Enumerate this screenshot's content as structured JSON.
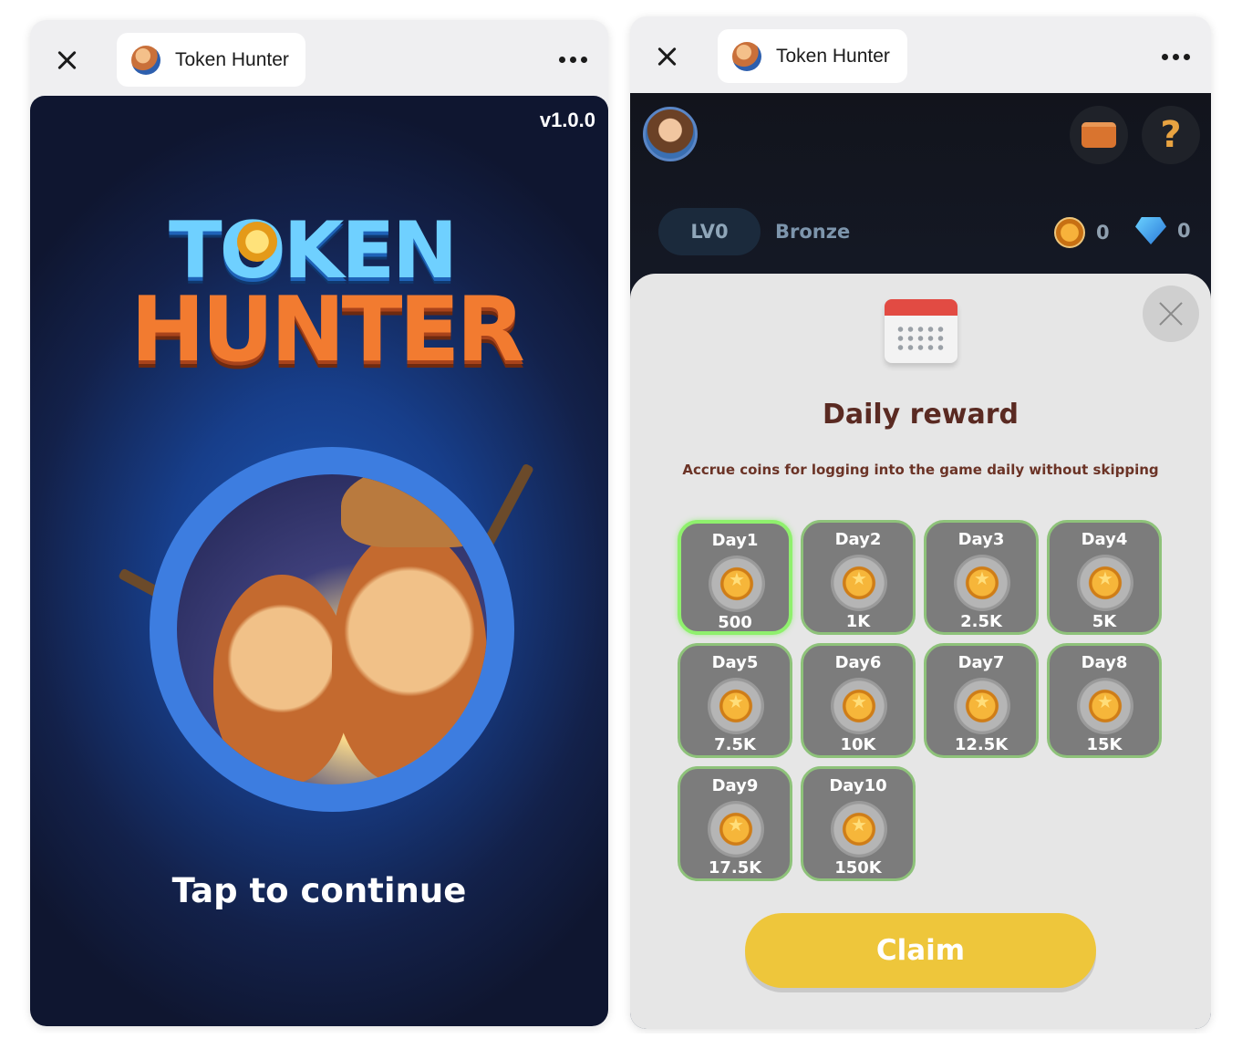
{
  "left_window": {
    "tab_title": "Token Hunter",
    "version": "v1.0.0",
    "logo_line1": "TOKEN",
    "logo_line2": "HUNTER",
    "tap_text": "Tap to continue"
  },
  "right_window": {
    "tab_title": "Token Hunter",
    "level": "LV0",
    "rank": "Bronze",
    "coins": "0",
    "gems": "0",
    "modal": {
      "title": "Daily reward",
      "subtitle": "Accrue coins for logging into the game daily without skipping",
      "days": [
        {
          "label": "Day1",
          "value": "500",
          "active": true
        },
        {
          "label": "Day2",
          "value": "1K",
          "active": false
        },
        {
          "label": "Day3",
          "value": "2.5K",
          "active": false
        },
        {
          "label": "Day4",
          "value": "5K",
          "active": false
        },
        {
          "label": "Day5",
          "value": "7.5K",
          "active": false
        },
        {
          "label": "Day6",
          "value": "10K",
          "active": false
        },
        {
          "label": "Day7",
          "value": "12.5K",
          "active": false
        },
        {
          "label": "Day8",
          "value": "15K",
          "active": false
        },
        {
          "label": "Day9",
          "value": "17.5K",
          "active": false
        },
        {
          "label": "Day10",
          "value": "150K",
          "active": false
        }
      ],
      "claim_label": "Claim"
    }
  },
  "colors": {
    "claim": "#eec63b",
    "title_brown": "#5a2a22",
    "active_border": "#8ff06d",
    "splash_blue": "#1d56b4"
  },
  "icons": [
    "close-icon",
    "more-icon",
    "wallet-icon",
    "help-icon",
    "coin-icon",
    "gem-icon",
    "calendar-icon",
    "modal-close-icon"
  ]
}
